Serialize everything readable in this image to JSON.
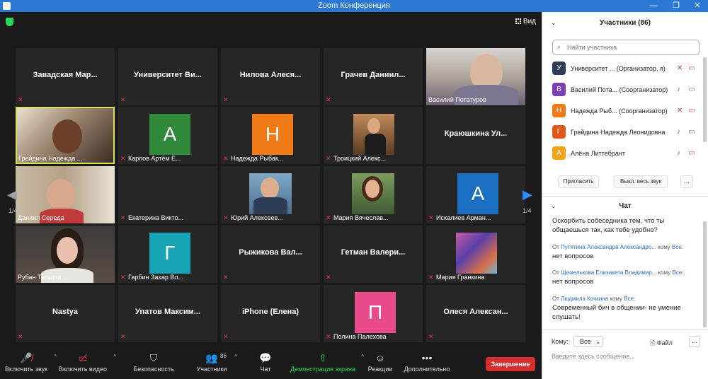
{
  "window": {
    "title": "Zoom Конференция"
  },
  "top": {
    "view_label": "Вид"
  },
  "tiles": [
    {
      "name": "Завадская Мар..."
    },
    {
      "name": "Университет Ви..."
    },
    {
      "name": "Нилова Алеся..."
    },
    {
      "name": "Грачев Даниил..."
    },
    {
      "label": "Василий Потатуров"
    },
    {
      "label": "Грейдина Надежда ..."
    },
    {
      "label": "Карпов Артём Е...",
      "initial": "А",
      "color": "#2f8b3a"
    },
    {
      "label": "Надежда Рыбак...",
      "initial": "Н",
      "color": "#f07a16"
    },
    {
      "label": "Троицкий Алекс..."
    },
    {
      "name": "Краюшкина Ул..."
    },
    {
      "label": "Даниил Середа"
    },
    {
      "label": "Екатерина Викто..."
    },
    {
      "label": "Юрий Алексеев..."
    },
    {
      "label": "Мария Вячеслав..."
    },
    {
      "label": "Искалиев Арман...",
      "initial": "А",
      "color": "#1a6fc2"
    },
    {
      "label": "Рубан Татьяна ..."
    },
    {
      "label": "Гарбин Захар Вл...",
      "initial": "Г",
      "color": "#17a5b5"
    },
    {
      "name": "Рыжикова Вал..."
    },
    {
      "name": "Гетман Валери..."
    },
    {
      "label": "Мария Гранкина"
    },
    {
      "name": "Nastya"
    },
    {
      "name": "Упатов Максим..."
    },
    {
      "name": "iPhone (Елена)"
    },
    {
      "label": "Полина Палехова",
      "initial": "П",
      "color": "#e84a8a"
    },
    {
      "name": "Олеся Алексан..."
    }
  ],
  "pager": {
    "left": "1/4",
    "right": "1/4"
  },
  "toolbar": {
    "items": [
      {
        "label": "Включить звук"
      },
      {
        "label": "Включить видео"
      },
      {
        "label": "Безопасность"
      },
      {
        "label": "Участники",
        "count": "86"
      },
      {
        "label": "Чат"
      },
      {
        "label": "Демонстрация экрана"
      },
      {
        "label": "Реакции"
      },
      {
        "label": "Дополнительно"
      }
    ],
    "end_label": "Завершение"
  },
  "participants_panel": {
    "title": "Участники (86)",
    "search_placeholder": "Найти участника",
    "rows": [
      {
        "initial": "У",
        "name": "Университет ...  (Организатор, я)",
        "color": "#2f3d57"
      },
      {
        "initial": "В",
        "name": "Василий Пота...  (Соорганизатор)",
        "color": "#7b3fb5"
      },
      {
        "initial": "Н",
        "name": "Надежда Рыб...  (Соорганизатор)",
        "color": "#f07a16"
      },
      {
        "initial": "Г",
        "name": "Грейдина Надежда Леонидовна",
        "color": "#e2561a"
      },
      {
        "initial": "А",
        "name": "Алёна Литтебрант",
        "color": "#f2a316"
      }
    ],
    "invite_label": "Пригласить",
    "mute_all_label": "Выкл. весь звук",
    "more_label": "..."
  },
  "chat": {
    "title": "Чат",
    "messages": [
      {
        "from_prefix": "",
        "from": "",
        "to_prefix": "",
        "to": "",
        "text": "Оскорбить собеседника тем, что ты общаешься так, как тебе удобно?"
      },
      {
        "from_prefix": "От",
        "from": "Путятина Александра Александро...",
        "to_prefix": "кому",
        "to": "Все:",
        "text": "нет вопросов"
      },
      {
        "from_prefix": "От",
        "from": "Щемелькова Елизавета Владимир...",
        "to_prefix": "кому",
        "to": "Все:",
        "text": "нет вопросов"
      },
      {
        "from_prefix": "От",
        "from": "Людмила Кочкина",
        "to_prefix": "кому",
        "to": "Все:",
        "text": "Современный бич в общении- не умение слушать!"
      }
    ],
    "to_label": "Кому:",
    "to_value": "Все",
    "file_label": "Файл",
    "more_label": "...",
    "input_placeholder": "Введите здесь сообщение..."
  }
}
